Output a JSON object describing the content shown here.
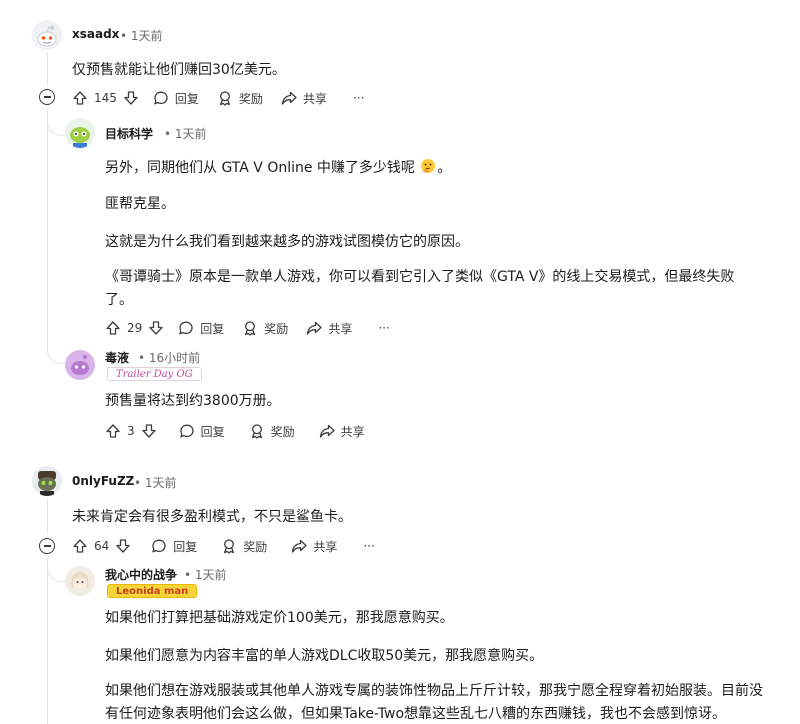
{
  "actions": {
    "reply": "回复",
    "award": "奖励",
    "share": "共享",
    "more": "···"
  },
  "comments": [
    {
      "username": "xsaadx",
      "time": "• 1天前",
      "paragraphs": [
        "仅预售就能让他们赚回30亿美元。"
      ],
      "votes": "145"
    },
    {
      "username": "目标科学",
      "time": "• 1天前",
      "paragraphs": [
        "另外，同期他们从 GTA V Online 中赚了多少钱呢",
        "。",
        "匪帮克星。",
        "这就是为什么我们看到越来越多的游戏试图模仿它的原因。",
        "《哥谭骑士》原本是一款单人游戏，你可以看到它引入了类似《GTA V》的线上交易模式，但最终失败了。"
      ],
      "votes": "29"
    },
    {
      "username": "毒液",
      "time": "• 16小时前",
      "flair": "Trailer Day OG",
      "paragraphs": [
        "预售量将达到约3800万册。"
      ],
      "votes": "3"
    },
    {
      "username": "0nlyFuZZ",
      "time": "• 1天前",
      "paragraphs": [
        "未来肯定会有很多盈利模式，不只是鲨鱼卡。"
      ],
      "votes": "64"
    },
    {
      "username": "我心中的战争",
      "time": "• 1天前",
      "flair": "Leonida man",
      "paragraphs": [
        "如果他们打算把基础游戏定价100美元，那我愿意购买。",
        "如果他们愿意为内容丰富的单人游戏DLC收取50美元，那我愿意购买。",
        "如果他们想在游戏服装或其他单人游戏专属的装饰性物品上斤斤计较，那我宁愿全程穿着初始服装。目前没有任何迹象表明他们会这么做，但如果Take-Two想靠这些乱七八糟的东西赚钱，我也不会感到惊讶。"
      ]
    }
  ],
  "colors": {
    "accent": "#c0479a",
    "text": "#1c1c1c",
    "muted": "#6a6a6a",
    "line": "#e4e4e4"
  }
}
